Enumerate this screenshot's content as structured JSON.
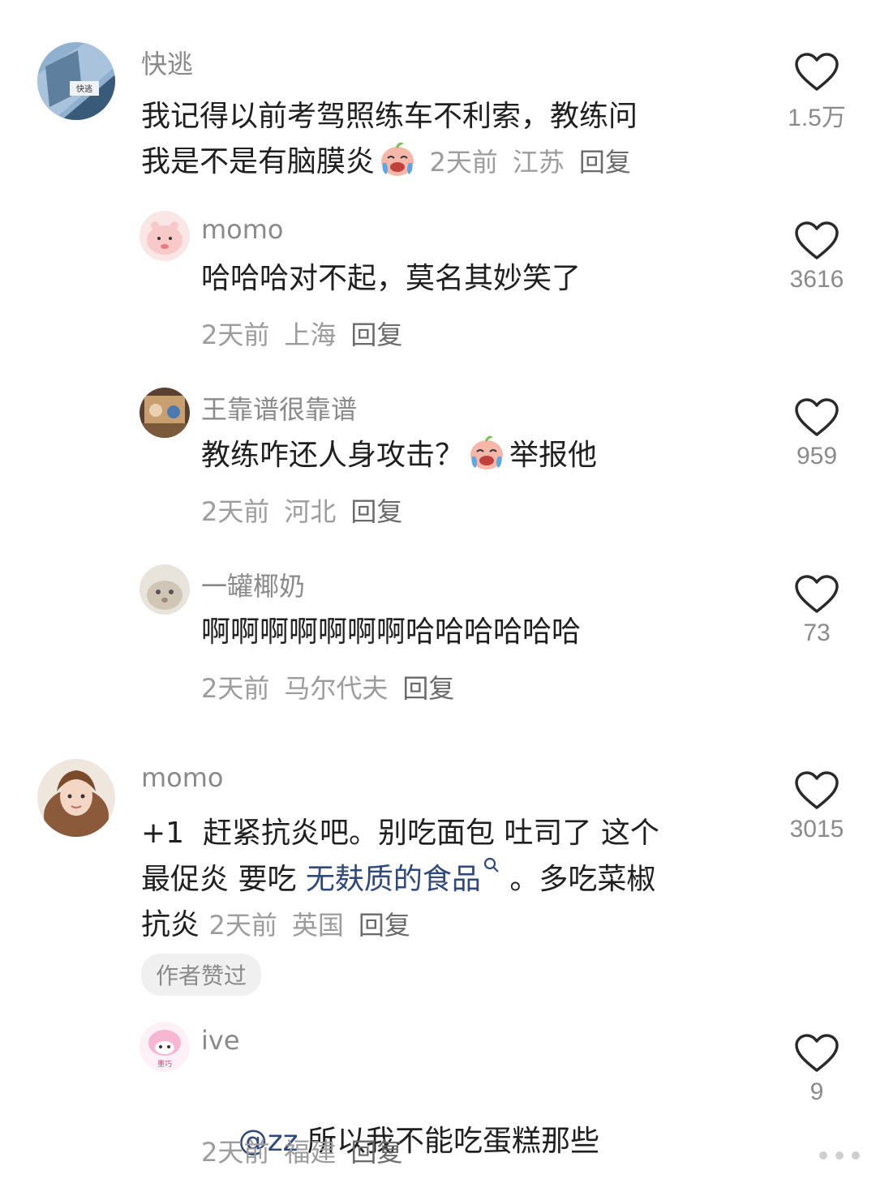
{
  "comments": [
    {
      "user": "快逃",
      "text_line1": "我记得以前考驾照练车不利索，教练问",
      "text_line2": "我是不是有脑膜炎",
      "time": "2天前",
      "location": "江苏",
      "reply": "回复",
      "likes": "1.5万",
      "avatar_label": "快逃"
    },
    {
      "user": "momo",
      "text": "哈哈哈对不起，莫名其妙笑了",
      "time": "2天前",
      "location": "上海",
      "reply": "回复",
      "likes": "3616"
    },
    {
      "user": "王靠谱很靠谱",
      "text_before": "教练咋还人身攻击？",
      "text_after": "举报他",
      "time": "2天前",
      "location": "河北",
      "reply": "回复",
      "likes": "959"
    },
    {
      "user": "一罐椰奶",
      "text": "啊啊啊啊啊啊啊哈哈哈哈哈哈",
      "time": "2天前",
      "location": "马尔代夫",
      "reply": "回复",
      "likes": "73"
    },
    {
      "user": "momo",
      "text_line1": "+1  赶紧抗炎吧。别吃面包 吐司了 这个",
      "text_line2_before": "最促炎 要吃 ",
      "text_line2_link": "无麸质的食品",
      "text_line2_after": " 。多吃菜椒",
      "text_line3": "抗炎",
      "time": "2天前",
      "location": "英国",
      "reply": "回复",
      "likes": "3015",
      "badge": "作者赞过"
    },
    {
      "user": "ive",
      "mention": "@zz",
      "text": " 所以我不能吃蛋糕那些",
      "time": "2天前",
      "location": "福建",
      "reply": "回复",
      "likes": "9",
      "avatar_label": "墨巧"
    }
  ]
}
